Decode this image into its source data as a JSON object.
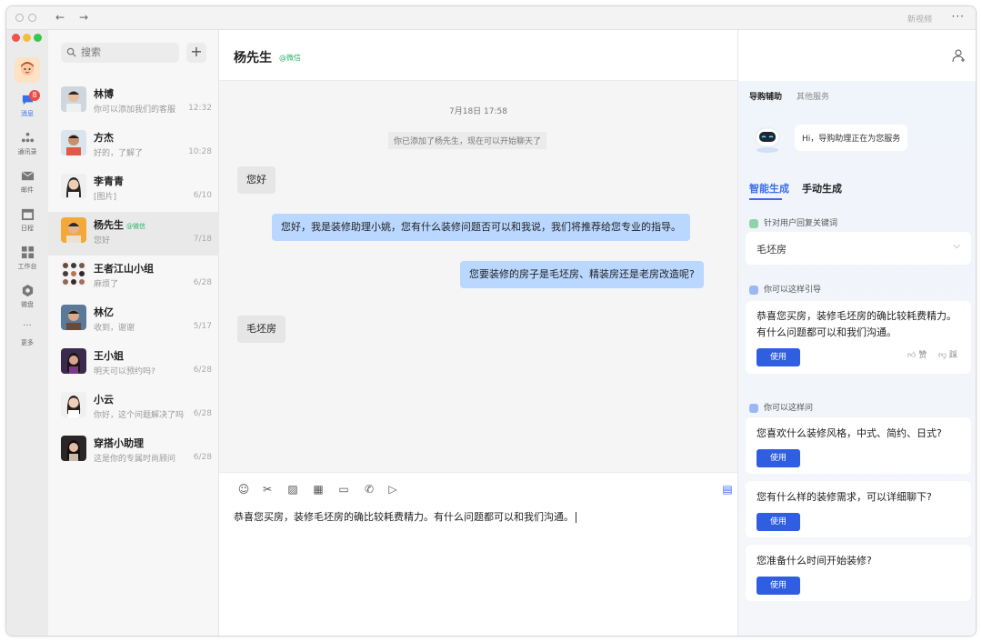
{
  "titlebar": {
    "right_text": "新视频"
  },
  "rail": {
    "items": [
      {
        "label": "消息",
        "icon": "chat-bubble-icon",
        "badge": "8"
      },
      {
        "label": "通讯录",
        "icon": "contacts-icon"
      },
      {
        "label": "邮件",
        "icon": "mail-icon"
      },
      {
        "label": "日程",
        "icon": "calendar-icon"
      },
      {
        "label": "工作台",
        "icon": "grid-icon"
      },
      {
        "label": "微盘",
        "icon": "drive-icon"
      },
      {
        "label": "更多",
        "icon": "more-icon"
      }
    ]
  },
  "search": {
    "placeholder": "搜索"
  },
  "conversations": [
    {
      "name": "林博",
      "preview": "你可以添加我们的客服",
      "time": "12:32"
    },
    {
      "name": "方杰",
      "preview": "好的，了解了",
      "time": "10:28"
    },
    {
      "name": "李青青",
      "preview": "[图片]",
      "time": "6/10"
    },
    {
      "name": "杨先生",
      "tag": "@微信",
      "preview": "您好",
      "time": "7/18"
    },
    {
      "name": "王者江山小组",
      "preview": "麻烦了",
      "time": "6/28"
    },
    {
      "name": "林亿",
      "preview": "收到，谢谢",
      "time": "5/17"
    },
    {
      "name": "王小姐",
      "preview": "明天可以预约吗?",
      "time": "6/28"
    },
    {
      "name": "小云",
      "preview": "你好，这个问题解决了吗?",
      "time": "6/28"
    },
    {
      "name": "穿搭小助理",
      "preview": "这是你的专属时尚顾问",
      "time": "6/28"
    }
  ],
  "chat": {
    "title": "杨先生",
    "title_tag": "@微信",
    "date": "7月18日  17:58",
    "system_msg": "你已添加了杨先生，现在可以开始聊天了",
    "messages": [
      {
        "dir": "in",
        "text": "您好"
      },
      {
        "dir": "out",
        "text": "您好，我是装修助理小姚，您有什么装修问题否可以和我说，我们将推荐给您专业的指导。"
      },
      {
        "dir": "out",
        "text": "您要装修的房子是毛坯房、精装房还是老房改造呢?"
      },
      {
        "dir": "in",
        "text": "毛坯房"
      }
    ],
    "draft": "恭喜您买房，装修毛坯房的确比较耗费精力。有什么问题都可以和我们沟通。"
  },
  "assistant": {
    "tabs": [
      "导购辅助",
      "其他服务"
    ],
    "greeting": "Hi，导购助理正在为您服务",
    "modes": [
      "智能生成",
      "手动生成"
    ],
    "keyword_label": "针对用户回复关键词",
    "keyword_value": "毛坯房",
    "guide_label": "你可以这样引导",
    "guide_text_1": "恭喜您买房，装修毛坯房的确比较耗费精力。",
    "guide_text_2": "有什么问题都可以和我们沟通。",
    "use_label": "使用",
    "like_label": "赞",
    "dislike_label": "踩",
    "ask_label": "你可以这样问",
    "questions": [
      "您喜欢什么装修风格，中式、简约、日式?",
      "您有什么样的装修需求，可以详细聊下?",
      "您准备什么时间开始装修?"
    ]
  }
}
